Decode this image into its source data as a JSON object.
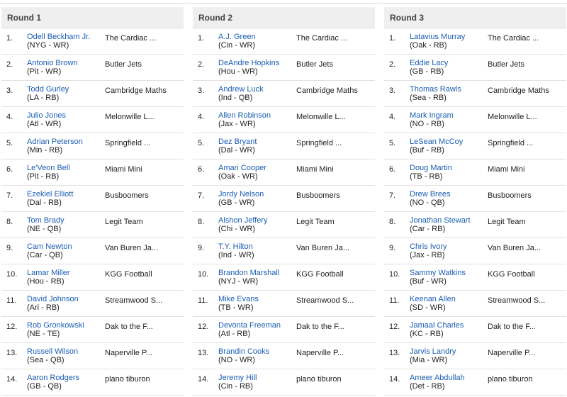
{
  "rounds": [
    {
      "title": "Round 1",
      "picks": [
        {
          "num": "1.",
          "player": "Odell Beckham Jr.",
          "info": "(NYG - WR)",
          "team": "The Cardiac ..."
        },
        {
          "num": "2.",
          "player": "Antonio Brown",
          "info": "(Pit - WR)",
          "team": "Butler Jets"
        },
        {
          "num": "3.",
          "player": "Todd Gurley",
          "info": "(LA - RB)",
          "team": "Cambridge Maths"
        },
        {
          "num": "4.",
          "player": "Julio Jones",
          "info": "(Atl - WR)",
          "team": "Melonwille L..."
        },
        {
          "num": "5.",
          "player": "Adrian Peterson",
          "info": "(Min - RB)",
          "team": "Springfield ..."
        },
        {
          "num": "6.",
          "player": "Le'Veon Bell",
          "info": "(Pit - RB)",
          "team": "Miami Mini"
        },
        {
          "num": "7.",
          "player": "Ezekiel Elliott",
          "info": "(Dal - RB)",
          "team": "Busboomers"
        },
        {
          "num": "8.",
          "player": "Tom Brady",
          "info": "(NE - QB)",
          "team": "Legit Team"
        },
        {
          "num": "9.",
          "player": "Cam Newton",
          "info": "(Car - QB)",
          "team": "Van Buren Ja..."
        },
        {
          "num": "10.",
          "player": "Lamar Miller",
          "info": "(Hou - RB)",
          "team": "KGG Football"
        },
        {
          "num": "11.",
          "player": "David Johnson",
          "info": "(Ari - RB)",
          "team": "Streamwood S..."
        },
        {
          "num": "12.",
          "player": "Rob Gronkowski",
          "info": "(NE - TE)",
          "team": "Dak to the F..."
        },
        {
          "num": "13.",
          "player": "Russell Wilson",
          "info": "(Sea - QB)",
          "team": "Naperville P..."
        },
        {
          "num": "14.",
          "player": "Aaron Rodgers",
          "info": "(GB - QB)",
          "team": "plano tiburon"
        }
      ]
    },
    {
      "title": "Round 2",
      "picks": [
        {
          "num": "1.",
          "player": "A.J. Green",
          "info": "(Cin - WR)",
          "team": "The Cardiac ..."
        },
        {
          "num": "2.",
          "player": "DeAndre Hopkins",
          "info": "(Hou - WR)",
          "team": "Butler Jets"
        },
        {
          "num": "3.",
          "player": "Andrew Luck",
          "info": "(Ind - QB)",
          "team": "Cambridge Maths"
        },
        {
          "num": "4.",
          "player": "Allen Robinson",
          "info": "(Jax - WR)",
          "team": "Melonwille L..."
        },
        {
          "num": "5.",
          "player": "Dez Bryant",
          "info": "(Dal - WR)",
          "team": "Springfield ..."
        },
        {
          "num": "6.",
          "player": "Amari Cooper",
          "info": "(Oak - WR)",
          "team": "Miami Mini"
        },
        {
          "num": "7.",
          "player": "Jordy Nelson",
          "info": "(GB - WR)",
          "team": "Busboomers"
        },
        {
          "num": "8.",
          "player": "Alshon Jeffery",
          "info": "(Chi - WR)",
          "team": "Legit Team"
        },
        {
          "num": "9.",
          "player": "T.Y. Hilton",
          "info": "(Ind - WR)",
          "team": "Van Buren Ja..."
        },
        {
          "num": "10.",
          "player": "Brandon Marshall",
          "info": "(NYJ - WR)",
          "team": "KGG Football"
        },
        {
          "num": "11.",
          "player": "Mike Evans",
          "info": "(TB - WR)",
          "team": "Streamwood S..."
        },
        {
          "num": "12.",
          "player": "Devonta Freeman",
          "info": "(Atl - RB)",
          "team": "Dak to the F..."
        },
        {
          "num": "13.",
          "player": "Brandin Cooks",
          "info": "(NO - WR)",
          "team": "Naperville P..."
        },
        {
          "num": "14.",
          "player": "Jeremy Hill",
          "info": "(Cin - RB)",
          "team": "plano tiburon"
        }
      ]
    },
    {
      "title": "Round 3",
      "picks": [
        {
          "num": "1.",
          "player": "Latavius Murray",
          "info": "(Oak - RB)",
          "team": "The Cardiac ..."
        },
        {
          "num": "2.",
          "player": "Eddie Lacy",
          "info": "(GB - RB)",
          "team": "Butler Jets"
        },
        {
          "num": "3.",
          "player": "Thomas Rawls",
          "info": "(Sea - RB)",
          "team": "Cambridge Maths"
        },
        {
          "num": "4.",
          "player": "Mark Ingram",
          "info": "(NO - RB)",
          "team": "Melonwille L..."
        },
        {
          "num": "5.",
          "player": "LeSean McCoy",
          "info": "(Buf - RB)",
          "team": "Springfield ..."
        },
        {
          "num": "6.",
          "player": "Doug Martin",
          "info": "(TB - RB)",
          "team": "Miami Mini"
        },
        {
          "num": "7.",
          "player": "Drew Brees",
          "info": "(NO - QB)",
          "team": "Busboomers"
        },
        {
          "num": "8.",
          "player": "Jonathan Stewart",
          "info": "(Car - RB)",
          "team": "Legit Team"
        },
        {
          "num": "9.",
          "player": "Chris Ivory",
          "info": "(Jax - RB)",
          "team": "Van Buren Ja..."
        },
        {
          "num": "10.",
          "player": "Sammy Watkins",
          "info": "(Buf - WR)",
          "team": "KGG Football"
        },
        {
          "num": "11.",
          "player": "Keenan Allen",
          "info": "(SD - WR)",
          "team": "Streamwood S..."
        },
        {
          "num": "12.",
          "player": "Jamaal Charles",
          "info": "(KC - RB)",
          "team": "Dak to the F..."
        },
        {
          "num": "13.",
          "player": "Jarvis Landry",
          "info": "(Mia - WR)",
          "team": "Naperville P..."
        },
        {
          "num": "14.",
          "player": "Ameer Abdullah",
          "info": "(Det - RB)",
          "team": "plano tiburon"
        }
      ]
    }
  ]
}
